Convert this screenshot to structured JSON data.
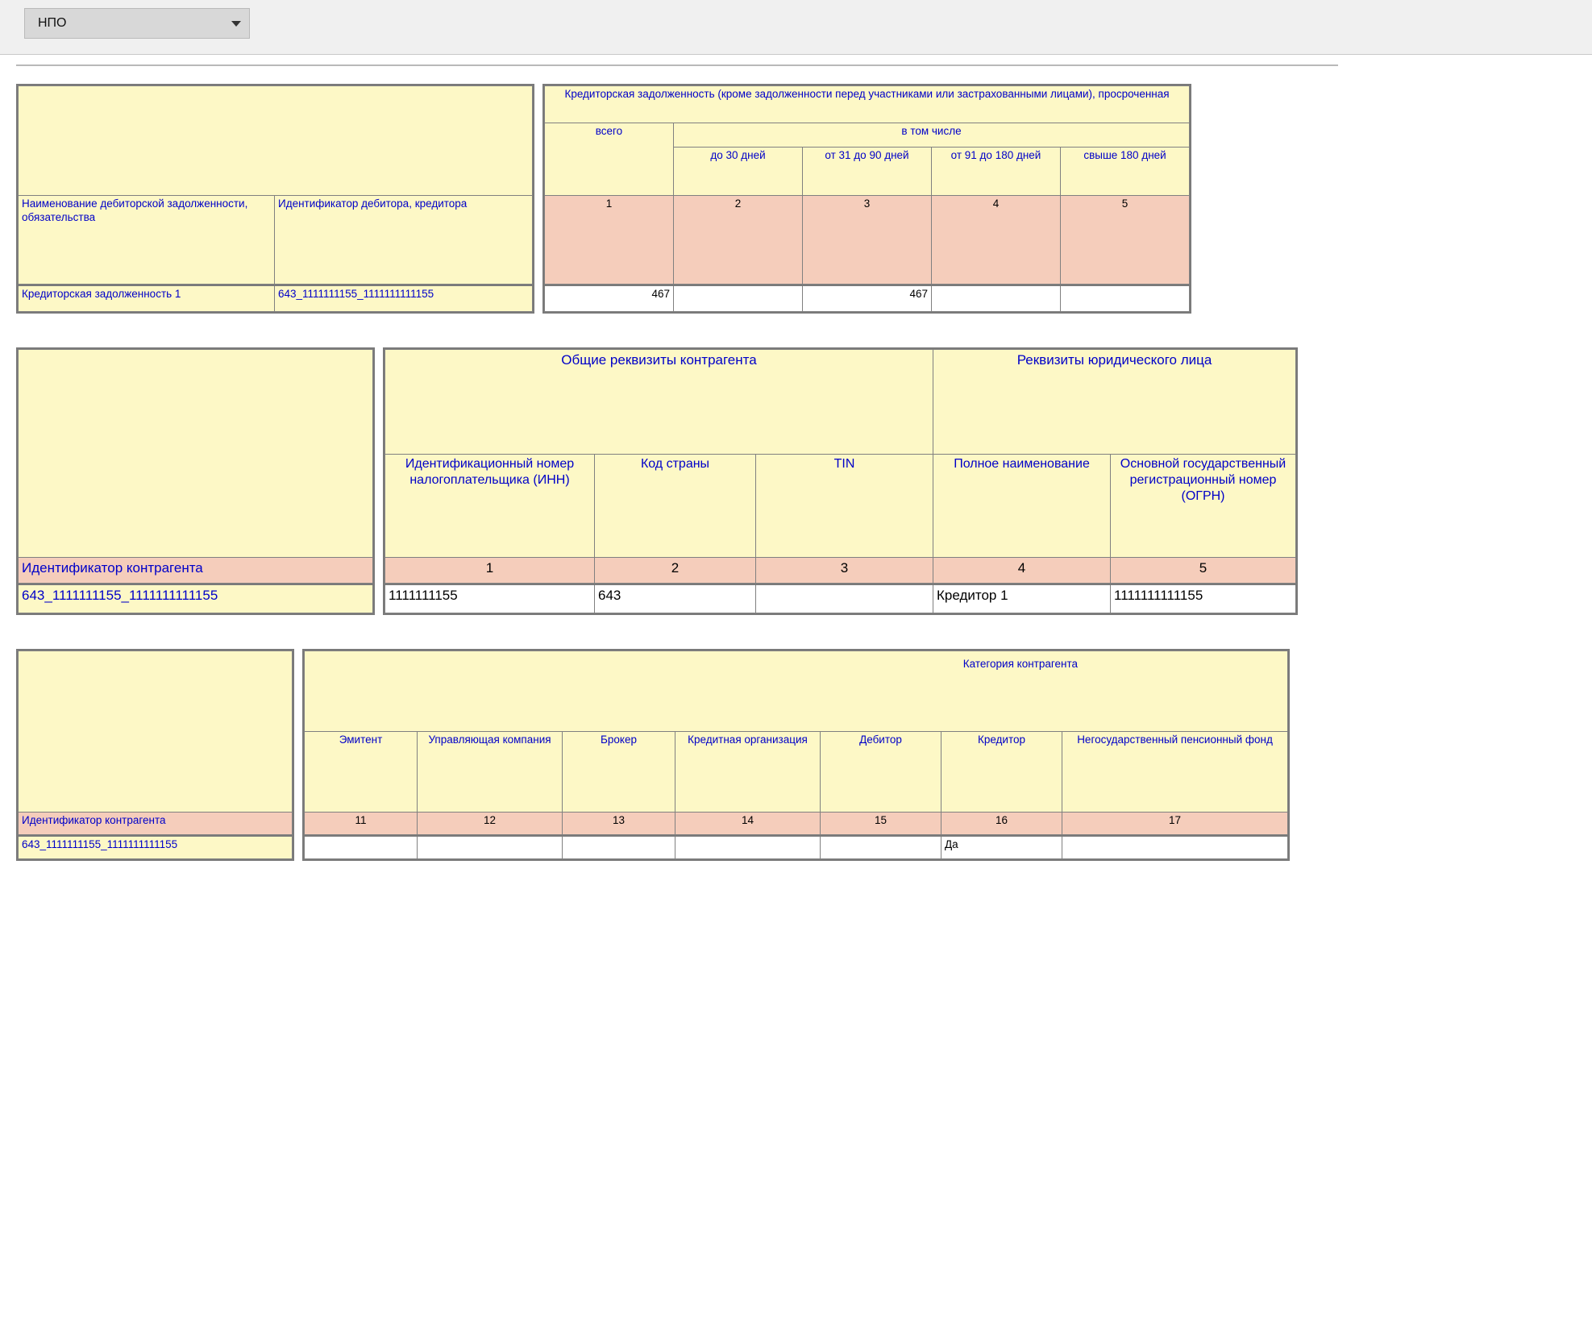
{
  "toolbar": {
    "dropdown_value": "НПО"
  },
  "table1": {
    "left": {
      "h1": "Наименование дебиторской задолженности, обязательства",
      "h2": "Идентификатор дебитора, кредитора",
      "row_label1": "Кредиторская задолженность 1",
      "row_label2": "643_1111111155_1111111111155"
    },
    "right": {
      "title": "Кредиторская задолженность (кроме задолженности перед участниками или застрахованными лицами), просроченная",
      "total": "всего",
      "inthat": "в том числе",
      "buckets": [
        "до 30 дней",
        "от 31 до 90 дней",
        "от 91 до 180 дней",
        "свыше 180 дней"
      ],
      "nums": [
        "1",
        "2",
        "3",
        "4",
        "5"
      ],
      "values": [
        "467",
        "",
        "467",
        "",
        ""
      ]
    }
  },
  "table2": {
    "left": {
      "axis": "Идентификатор контрагента",
      "row_id": "643_1111111155_1111111111155"
    },
    "top": {
      "group1": "Общие реквизиты контрагента",
      "group2": "Реквизиты юридического лица",
      "cols": [
        "Идентификационный номер налогоплательщика (ИНН)",
        "Код страны",
        "TIN",
        "Полное наименование",
        "Основной государственный регистрационный номер (ОГРН)"
      ],
      "nums": [
        "1",
        "2",
        "3",
        "4",
        "5"
      ]
    },
    "values": [
      "1111111155",
      "643",
      "",
      "Кредитор 1",
      "1111111111155"
    ]
  },
  "table3": {
    "left": {
      "axis": "Идентификатор контрагента",
      "row_id": "643_1111111155_1111111111155"
    },
    "top": {
      "title": "Категория контрагента",
      "cols": [
        "Эмитент",
        "Управляющая компания",
        "Брокер",
        "Кредитная организация",
        "Дебитор",
        "Кредитор",
        "Негосударственный пенсионный фонд"
      ],
      "nums": [
        "11",
        "12",
        "13",
        "14",
        "15",
        "16",
        "17"
      ]
    },
    "values": [
      "",
      "",
      "",
      "",
      "",
      "Да",
      ""
    ]
  }
}
